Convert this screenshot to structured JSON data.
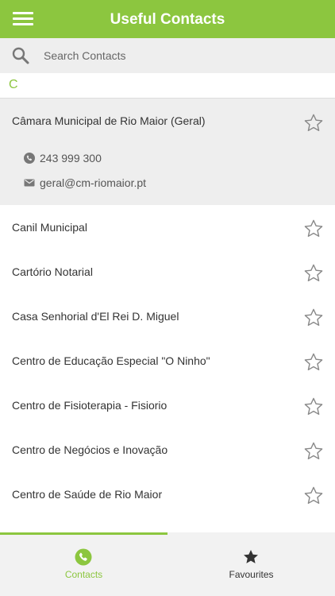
{
  "app": {
    "title": "Useful Contacts",
    "accent_color": "#8cc63f",
    "menu_icon": "hamburger-menu-icon"
  },
  "search": {
    "placeholder": "Search Contacts",
    "value": "",
    "icon": "search-icon"
  },
  "section": {
    "letter": "C"
  },
  "expanded_contact": {
    "name": "Câmara Municipal de Rio Maior (Geral)",
    "phone": "243 999 300",
    "email": "geral@cm-riomaior.pt",
    "favourite": false
  },
  "contacts": [
    {
      "name": "Canil Municipal",
      "favourite": false
    },
    {
      "name": "Cartório Notarial",
      "favourite": false
    },
    {
      "name": "Casa Senhorial d'El Rei D. Miguel",
      "favourite": false
    },
    {
      "name": "Centro de Educação Especial \"O Ninho\"",
      "favourite": false
    },
    {
      "name": "Centro de Fisioterapia - Fisiorio",
      "favourite": false
    },
    {
      "name": "Centro de Negócios e Inovação",
      "favourite": false
    },
    {
      "name": "Centro de Saúde de Rio Maior",
      "favourite": false
    }
  ],
  "tabs": {
    "contacts": {
      "label": "Contacts",
      "icon": "phone-circle-icon",
      "active": true
    },
    "favourites": {
      "label": "Favourites",
      "icon": "star-icon",
      "active": false
    }
  }
}
